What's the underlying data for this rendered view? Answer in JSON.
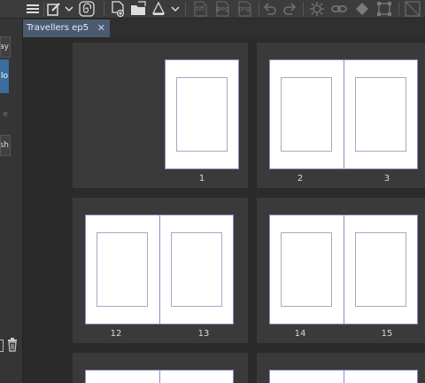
{
  "toolbar": {
    "icons": [
      "menu-icon",
      "pen-tool-icon",
      "chevron-down-icon",
      "spiral-icon",
      "new-file-icon",
      "open-folder-icon",
      "save-icon",
      "chevron-down-icon",
      "export-tiff-icon",
      "export-jpeg-icon",
      "export-png-icon",
      "undo-icon",
      "redo-icon",
      "burst-icon",
      "chain-icon",
      "fill-icon",
      "transform-icon",
      "ruler-icon"
    ],
    "export_tiff": "tiff",
    "export_jpeg": "jpeg",
    "export_png": "png"
  },
  "brush_panel": {
    "items": [
      "Spray",
      "lo",
      "e",
      "sh"
    ],
    "selected": "lo"
  },
  "tab": {
    "title": "Travellers ep5",
    "close": "✕"
  },
  "pages": {
    "p1": "1",
    "p2": "2",
    "p3": "3",
    "p12": "12",
    "p13": "13",
    "p14": "14",
    "p15": "15"
  },
  "colors": {
    "tab_active": "#4a5a70",
    "selected_item": "#3d6d9e",
    "page_border": "#8a8cc6"
  }
}
